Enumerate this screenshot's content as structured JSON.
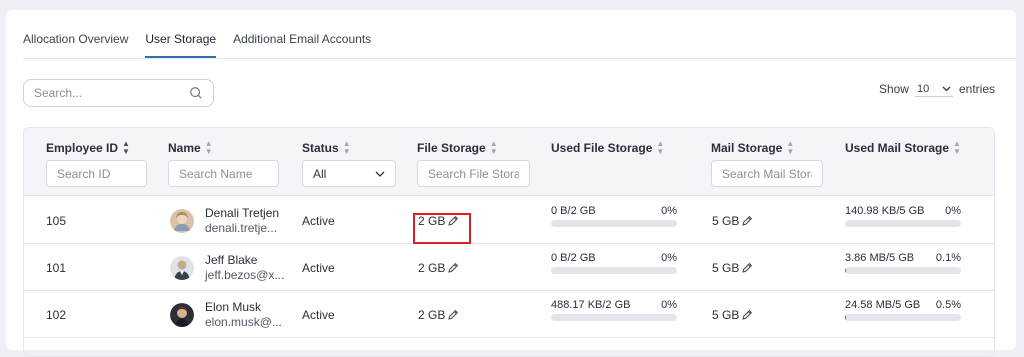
{
  "tabs": [
    {
      "label": "Allocation Overview"
    },
    {
      "label": "User Storage"
    },
    {
      "label": "Additional Email Accounts"
    }
  ],
  "search": {
    "placeholder": "Search..."
  },
  "show_entries": {
    "show": "Show",
    "value": "10",
    "entries": "entries"
  },
  "columns": {
    "employee_id": "Employee ID",
    "name": "Name",
    "status": "Status",
    "file_storage": "File Storage",
    "used_file_storage": "Used File Storage",
    "mail_storage": "Mail Storage",
    "used_mail_storage": "Used Mail Storage"
  },
  "filters": {
    "id_placeholder": "Search ID",
    "name_placeholder": "Search Name",
    "status_value": "All",
    "file_placeholder": "Search File Storage",
    "mail_placeholder": "Search Mail Storage"
  },
  "rows": [
    {
      "id": "105",
      "name": "Denali Tretjen",
      "email": "denali.tretje...",
      "status": "Active",
      "file_storage": "2 GB",
      "used_file": "0 B/2 GB",
      "used_file_pct": "0%",
      "used_file_fraction": 0,
      "mail_storage": "5 GB",
      "used_mail": "140.98 KB/5 GB",
      "used_mail_pct": "0%",
      "used_mail_fraction": 0
    },
    {
      "id": "101",
      "name": "Jeff Blake",
      "email": "jeff.bezos@x...",
      "status": "Active",
      "file_storage": "2 GB",
      "used_file": "0 B/2 GB",
      "used_file_pct": "0%",
      "used_file_fraction": 0,
      "mail_storage": "5 GB",
      "used_mail": "3.86 MB/5 GB",
      "used_mail_pct": "0.1%",
      "used_mail_fraction": 0.001
    },
    {
      "id": "102",
      "name": "Elon Musk",
      "email": "elon.musk@...",
      "status": "Active",
      "file_storage": "2 GB",
      "used_file": "488.17 KB/2 GB",
      "used_file_pct": "0%",
      "used_file_fraction": 0,
      "mail_storage": "5 GB",
      "used_mail": "24.58 MB/5 GB",
      "used_mail_pct": "0.5%",
      "used_mail_fraction": 0.005
    }
  ],
  "colors": {
    "accent": "#2f6fb8",
    "highlight": "#d8202a"
  },
  "icons": [
    "search-icon",
    "sort-icon",
    "pencil-icon",
    "chevron-down-icon"
  ]
}
